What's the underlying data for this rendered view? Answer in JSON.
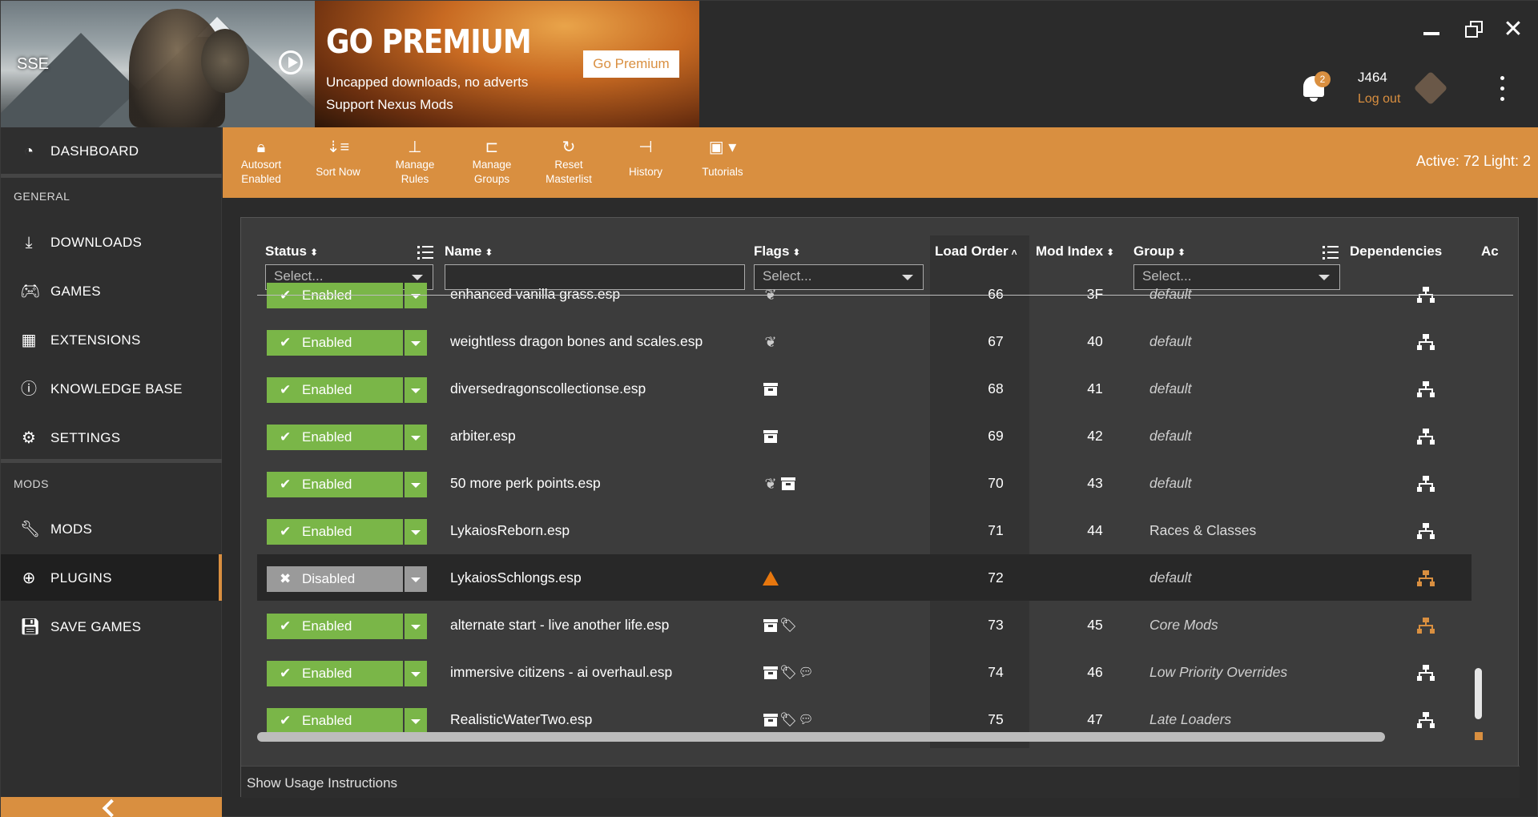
{
  "header": {
    "game_label": "SSE",
    "premium": {
      "title": "GO PREMIUM",
      "line1": "Uncapped downloads, no adverts",
      "line2": "Support Nexus Mods",
      "button": "Go Premium"
    },
    "notifications_count": "2",
    "username": "J464",
    "logout": "Log out"
  },
  "sidebar": {
    "dashboard": "DASHBOARD",
    "section_general": "GENERAL",
    "general_items": [
      {
        "label": "DOWNLOADS",
        "icon": "download-icon"
      },
      {
        "label": "GAMES",
        "icon": "gamepad-icon"
      },
      {
        "label": "EXTENSIONS",
        "icon": "extensions-icon"
      },
      {
        "label": "KNOWLEDGE BASE",
        "icon": "info-icon"
      },
      {
        "label": "SETTINGS",
        "icon": "gear-icon"
      }
    ],
    "section_mods": "MODS",
    "mods_items": [
      {
        "label": "MODS",
        "icon": "wrench-icon"
      },
      {
        "label": "PLUGINS",
        "icon": "plus-circle-icon",
        "active": true
      },
      {
        "label": "SAVE GAMES",
        "icon": "save-icon"
      }
    ]
  },
  "toolbar": {
    "autosort": [
      "Autosort",
      "Enabled"
    ],
    "sort_now": "Sort Now",
    "manage_rules": [
      "Manage",
      "Rules"
    ],
    "manage_groups": [
      "Manage",
      "Groups"
    ],
    "reset_masterlist": [
      "Reset",
      "Masterlist"
    ],
    "history": "History",
    "tutorials": "Tutorials",
    "active_count": "Active: 72 Light: 2"
  },
  "table": {
    "columns": {
      "status": "Status",
      "name": "Name",
      "flags": "Flags",
      "load_order": "Load Order",
      "mod_index": "Mod Index",
      "group": "Group",
      "dependencies": "Dependencies",
      "actions": "Ac"
    },
    "filters": {
      "status_placeholder": "Select...",
      "flags_placeholder": "Select...",
      "group_placeholder": "Select..."
    },
    "rows": [
      {
        "status": "Enabled",
        "name": "enhanced vanilla grass.esp",
        "flags": [
          "light"
        ],
        "load_order": "66",
        "mod_index": "3F",
        "group": "default",
        "group_italic": true,
        "dep_warn": false
      },
      {
        "status": "Enabled",
        "name": "weightless dragon bones and scales.esp",
        "flags": [
          "light"
        ],
        "load_order": "67",
        "mod_index": "40",
        "group": "default",
        "group_italic": true,
        "dep_warn": false
      },
      {
        "status": "Enabled",
        "name": "diversedragonscollectionse.esp",
        "flags": [
          "master"
        ],
        "load_order": "68",
        "mod_index": "41",
        "group": "default",
        "group_italic": true,
        "dep_warn": false
      },
      {
        "status": "Enabled",
        "name": "arbiter.esp",
        "flags": [
          "master"
        ],
        "load_order": "69",
        "mod_index": "42",
        "group": "default",
        "group_italic": true,
        "dep_warn": false
      },
      {
        "status": "Enabled",
        "name": "50 more perk points.esp",
        "flags": [
          "light",
          "master"
        ],
        "load_order": "70",
        "mod_index": "43",
        "group": "default",
        "group_italic": true,
        "dep_warn": false
      },
      {
        "status": "Enabled",
        "name": "LykaiosReborn.esp",
        "flags": [],
        "load_order": "71",
        "mod_index": "44",
        "group": "Races & Classes",
        "group_italic": false,
        "dep_warn": false
      },
      {
        "status": "Disabled",
        "name": "LykaiosSchlongs.esp",
        "flags": [
          "warning"
        ],
        "load_order": "72",
        "mod_index": "",
        "group": "default",
        "group_italic": true,
        "dep_warn": true
      },
      {
        "status": "Enabled",
        "name": "alternate start - live another life.esp",
        "flags": [
          "master",
          "tag"
        ],
        "load_order": "73",
        "mod_index": "45",
        "group": "Core Mods",
        "group_italic": true,
        "dep_warn": true
      },
      {
        "status": "Enabled",
        "name": "immersive citizens - ai overhaul.esp",
        "flags": [
          "master",
          "tag",
          "note"
        ],
        "load_order": "74",
        "mod_index": "46",
        "group": "Low Priority Overrides",
        "group_italic": true,
        "dep_warn": false
      },
      {
        "status": "Enabled",
        "name": "RealisticWaterTwo.esp",
        "flags": [
          "master",
          "tag",
          "note"
        ],
        "load_order": "75",
        "mod_index": "47",
        "group": "Late Loaders",
        "group_italic": true,
        "dep_warn": false
      }
    ]
  },
  "footer": {
    "usage": "Show Usage Instructions"
  },
  "colors": {
    "accent": "#d98f40",
    "enabled": "#7ab648",
    "disabled": "#9a9a9a",
    "warning": "#e7770e"
  }
}
